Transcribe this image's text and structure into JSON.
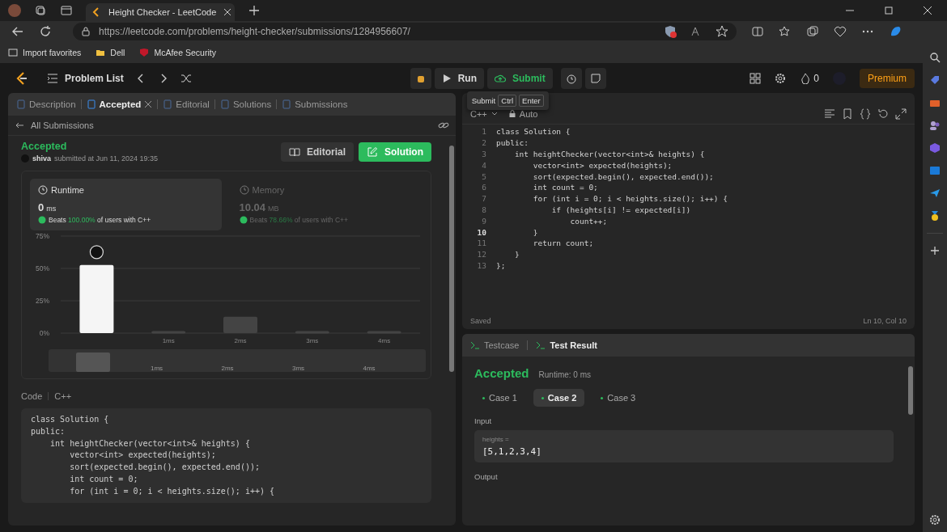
{
  "browser": {
    "tab_title": "Height Checker - LeetCode",
    "url": "https://leetcode.com/problems/height-checker/submissions/1284956607/",
    "favorites": [
      "Import favorites",
      "Dell",
      "McAfee Security"
    ]
  },
  "header": {
    "problem_list": "Problem List",
    "run": "Run",
    "submit": "Submit",
    "streak": "0",
    "premium": "Premium",
    "shortcut": [
      "Submit",
      "Ctrl",
      "Enter"
    ]
  },
  "tabs": [
    {
      "label": "Description",
      "selected": false,
      "closable": false
    },
    {
      "label": "Accepted",
      "selected": true,
      "closable": true
    },
    {
      "label": "Editorial",
      "selected": false,
      "closable": false
    },
    {
      "label": "Solutions",
      "selected": false,
      "closable": false
    },
    {
      "label": "Submissions",
      "selected": false,
      "closable": false
    }
  ],
  "back_link": "All Submissions",
  "submission": {
    "status": "Accepted",
    "user": "shiva",
    "submitted": "submitted at Jun 11, 2024 19:35",
    "buttons": [
      "Editorial",
      "Solution"
    ]
  },
  "stats": [
    {
      "label": "Runtime",
      "value": "0",
      "unit": "ms",
      "beats": "Beats",
      "percent": "100.00%",
      "suffix": "of users with C++",
      "selected": true
    },
    {
      "label": "Memory",
      "value": "10.04",
      "unit": "MB",
      "beats": "Beats",
      "percent": "78.66%",
      "suffix": "of users with C++",
      "selected": false
    }
  ],
  "chart_data": {
    "type": "bar",
    "x": [
      0,
      1,
      2,
      3,
      4
    ],
    "xlim": [
      -0.5,
      4.5
    ],
    "values": [
      52,
      1,
      12,
      1,
      1
    ],
    "ylim": [
      0,
      75
    ],
    "yticks": [
      {
        "value": 0,
        "label": "0%"
      },
      {
        "value": 25,
        "label": "25%"
      },
      {
        "value": 50,
        "label": "50%"
      },
      {
        "value": 75,
        "label": "75%"
      }
    ],
    "xticks": [
      {
        "value": 1,
        "label": "1ms"
      },
      {
        "value": 2,
        "label": "2ms"
      },
      {
        "value": 3,
        "label": "3ms"
      },
      {
        "value": 4,
        "label": "4ms"
      }
    ]
  },
  "overview_labels": [
    "1ms",
    "2ms",
    "3ms",
    "4ms"
  ],
  "code": {
    "label": "Code",
    "language": "C++",
    "lines": [
      "class Solution {",
      "public:",
      "    int heightChecker(vector<int>& heights) {",
      "        vector<int> expected(heights);",
      "        sort(expected.begin(), expected.end());",
      "        int count = 0;",
      "        for (int i = 0; i < heights.size(); i++) {"
    ]
  },
  "editor": {
    "language": "C++",
    "mode": "Auto",
    "status": "Saved",
    "position": "Ln 10, Col 10",
    "lines": [
      {
        "n": "1",
        "text": "class Solution {",
        "current": false
      },
      {
        "n": "2",
        "text": "public:",
        "current": false
      },
      {
        "n": "3",
        "text": "    int heightChecker(vector<int>& heights) {",
        "current": false
      },
      {
        "n": "4",
        "text": "        vector<int> expected(heights);",
        "current": false
      },
      {
        "n": "5",
        "text": "        sort(expected.begin(), expected.end());",
        "current": false
      },
      {
        "n": "6",
        "text": "        int count = 0;",
        "current": false
      },
      {
        "n": "7",
        "text": "        for (int i = 0; i < heights.size(); i++) {",
        "current": false
      },
      {
        "n": "8",
        "text": "            if (heights[i] != expected[i])",
        "current": false
      },
      {
        "n": "9",
        "text": "                count++;",
        "current": false
      },
      {
        "n": "10",
        "text": "        }",
        "current": true
      },
      {
        "n": "11",
        "text": "        return count;",
        "current": false
      },
      {
        "n": "12",
        "text": "    }",
        "current": false
      },
      {
        "n": "13",
        "text": "};",
        "current": false
      }
    ]
  },
  "result": {
    "tabs": [
      {
        "label": "Testcase",
        "selected": false
      },
      {
        "label": "Test Result",
        "selected": true
      }
    ],
    "status": "Accepted",
    "runtime": "Runtime: 0 ms",
    "cases": [
      {
        "label": "Case 1",
        "selected": false
      },
      {
        "label": "Case 2",
        "selected": true
      },
      {
        "label": "Case 3",
        "selected": false
      }
    ],
    "input_label": "Input",
    "param": "heights =",
    "value": "[5,1,2,3,4]",
    "output_label": "Output"
  }
}
